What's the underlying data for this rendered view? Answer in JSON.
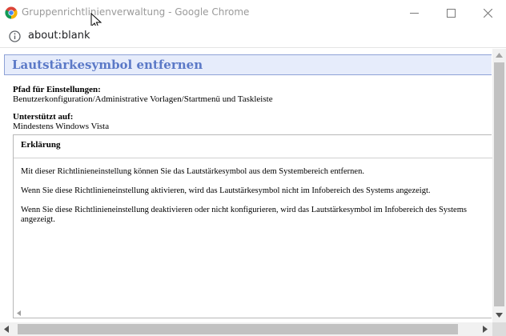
{
  "window": {
    "title": "Gruppenrichtlinienverwaltung - Google Chrome",
    "minimize_icon": "minimize-icon",
    "maximize_icon": "maximize-icon",
    "close_icon": "close-icon"
  },
  "addressbar": {
    "url": "about:blank",
    "info_icon": "info-icon"
  },
  "page": {
    "title": "Lautstärkesymbol entfernen",
    "path_label": "Pfad für Einstellungen:",
    "path_value": "Benutzerkonfiguration/Administrative Vorlagen/Startmenü und Taskleiste",
    "supported_label": "Unterstützt auf:",
    "supported_value": "Mindestens Windows Vista",
    "explain_title": "Erklärung",
    "paragraphs": [
      "Mit dieser Richtlinieneinstellung können Sie das Lautstärkesymbol aus dem Systembereich entfernen.",
      "Wenn Sie diese Richtlinieneinstellung aktivieren, wird das Lautstärkesymbol nicht im Infobereich des Systems angezeigt.",
      "Wenn Sie diese Richtlinieneinstellung deaktivieren oder nicht konfigurieren, wird das Lautstärkesymbol im Infobereich des Systems angezeigt."
    ]
  },
  "colors": {
    "title_blue": "#5b79c7",
    "header_bg": "#e6ecfb",
    "header_border": "#8ea2d6"
  }
}
